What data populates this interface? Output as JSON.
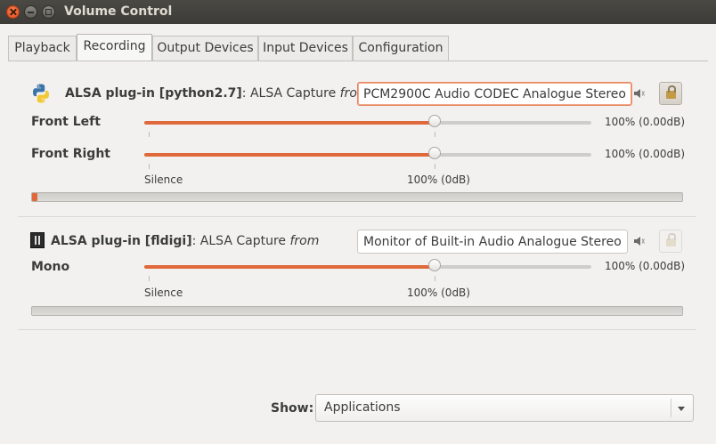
{
  "window": {
    "title": "Volume Control"
  },
  "tabs": [
    {
      "label": "Playback"
    },
    {
      "label": "Recording"
    },
    {
      "label": "Output Devices"
    },
    {
      "label": "Input Devices"
    },
    {
      "label": "Configuration"
    }
  ],
  "active_tab": "Recording",
  "streams": [
    {
      "app_icon": "python-icon",
      "name": "ALSA plug-in [python2.7]",
      "description": ": ALSA Capture",
      "from_label": "from",
      "device": "PCM2900C Audio CODEC Analogue Stereo",
      "locked": true,
      "channels": [
        {
          "label": "Front Left",
          "level": 1.0,
          "value": "100% (0.00dB)"
        },
        {
          "label": "Front Right",
          "level": 1.0,
          "value": "100% (0.00dB)"
        }
      ],
      "scale": {
        "min_label": "Silence",
        "ref_label": "100% (0dB)"
      },
      "peak_level": 0.01
    },
    {
      "app_icon": "terminal-icon",
      "name": "ALSA plug-in [fldigi]",
      "description": ": ALSA Capture",
      "from_label": "from",
      "device": "Monitor of Built-in Audio Analogue Stereo",
      "locked": false,
      "channels": [
        {
          "label": "Mono",
          "level": 1.0,
          "value": "100% (0.00dB)"
        }
      ],
      "scale": {
        "min_label": "Silence",
        "ref_label": "100% (0dB)"
      },
      "peak_level": 0.0
    }
  ],
  "footer": {
    "show_label": "Show:",
    "show_value": "Applications"
  },
  "colors": {
    "accent": "#e0693b",
    "titlebar": "#3c3b37",
    "background": "#f2f1f0"
  }
}
